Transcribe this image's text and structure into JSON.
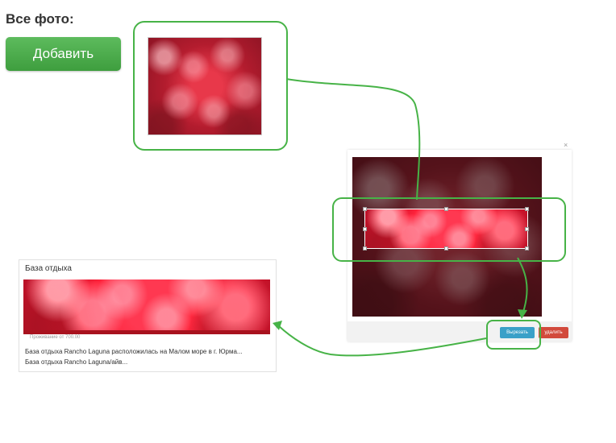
{
  "page": {
    "title": "Все фото:"
  },
  "toolbar": {
    "add_label": "Добавить"
  },
  "dialog": {
    "close_glyph": "×",
    "crop_button_label": "Вырезать",
    "delete_button_label": "удалить"
  },
  "card": {
    "title": "База отдыха",
    "caption": "Проживание от 700.00",
    "text_lines": [
      "База отдыха Rancho Laguna расположилась на Малом море в г. Юрма...",
      "База отдыха Rancho Laguna/айв..."
    ]
  },
  "colors": {
    "accent_green": "#47b347",
    "crop_button": "#3aa0c8",
    "delete_button": "#d24a3c"
  }
}
